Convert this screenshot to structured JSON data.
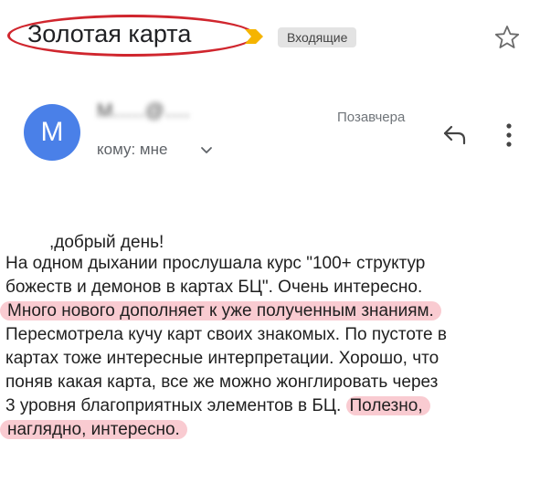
{
  "header": {
    "subject": "Золотая карта",
    "label": "Входящие"
  },
  "sender": {
    "avatar_letter": "M",
    "email_blurred": "M.....@....",
    "date": "Позавчера",
    "to_label": "кому: мне"
  },
  "message": {
    "greeting": ",добрый день!",
    "lines": [
      "На одном дыхании прослушала курс \"100+ структур",
      "божеств и демонов в картах БЦ\". Очень интересно.",
      "Много нового дополняет к уже полученным знаниям.",
      "Пересмотрела кучу карт своих знакомых. По пустоте в",
      "картах тоже интересные интерпретации. Хорошо, что",
      "поняв какая карта, все же можно жонглировать через"
    ],
    "line7_plain": "3 уровня благоприятных элементов в БЦ.",
    "line7_highlight": "Полезно,",
    "line8_highlight": "наглядно, интересно."
  },
  "colors": {
    "avatar": "#4a80e8",
    "highlight": "#f4a0ac",
    "circle_annotation": "#d0262e",
    "important_marker": "#f5b400"
  },
  "icons": [
    "important-marker-icon",
    "star-icon",
    "reply-icon",
    "more-vert-icon",
    "chevron-down-icon"
  ]
}
